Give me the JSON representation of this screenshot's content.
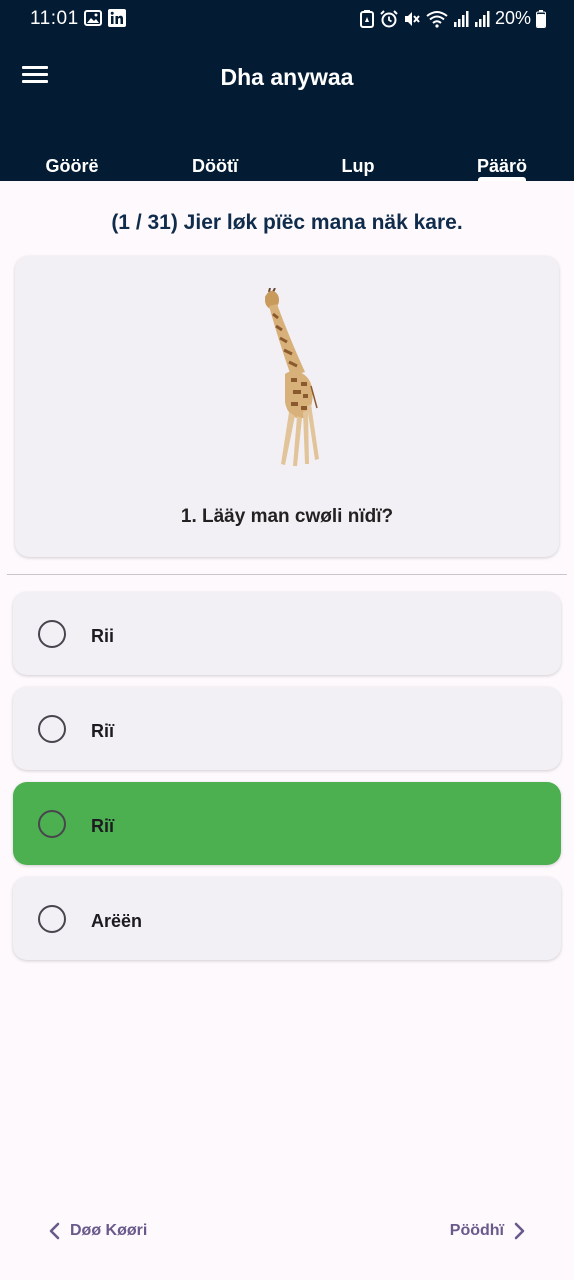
{
  "status_bar": {
    "time": "11:01",
    "battery": "20%",
    "icons": [
      "image-icon",
      "linkedin-icon",
      "battery-saver-icon",
      "alarm-icon",
      "mute-icon",
      "wifi-icon",
      "signal-icon",
      "signal-icon",
      "battery-icon"
    ]
  },
  "app_bar": {
    "title": "Dha anywaa",
    "menu_icon": "menu-icon"
  },
  "tabs": [
    {
      "label": "Göörë"
    },
    {
      "label": "Döötï"
    },
    {
      "label": "Lup"
    },
    {
      "label": "Päärö",
      "active": true
    }
  ],
  "quiz": {
    "progress": "(1 / 31) Jier løk pïëc mana näk kare.",
    "question": "1. Lääy man cwøli nïdï?",
    "image": "giraffe-image",
    "options": [
      {
        "label": "Rii",
        "selected": false
      },
      {
        "label": "Riï",
        "selected": false
      },
      {
        "label": "Riï",
        "selected": true
      },
      {
        "label": "Arëën",
        "selected": false
      }
    ]
  },
  "navigation": {
    "prev_label": "Døø Køøri",
    "next_label": "Pöödhï"
  },
  "colors": {
    "header_bg": "#041b34",
    "selected_option": "#4caf50",
    "card_bg": "#f3f0f5",
    "nav_text": "#6a5a8c"
  }
}
